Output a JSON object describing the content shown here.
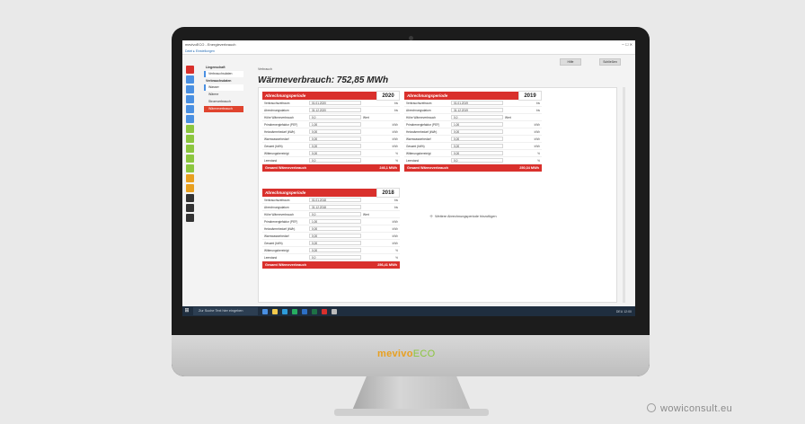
{
  "window": {
    "title": "mevivoECO - Energieverbrauch",
    "menu": "Datei  ▸  Einstellungen"
  },
  "toolbar": {
    "btn1": "Hilfe",
    "btn2": "Schließen"
  },
  "navigation": {
    "header1": "Liegenschaft",
    "header2": "Verbrauchsdaten",
    "items": [
      "Verbrauchsdaten",
      "Wasser",
      "Wärme",
      "Stromverbrauch",
      "Wärmeverbrauch"
    ]
  },
  "breadcrumb": "Verbrauch",
  "page_title": "Wärmeverbrauch: 752,85 MWh",
  "cards": [
    {
      "header": "Abrechnungsperiode",
      "year": "2020",
      "rows": [
        {
          "label": "Verbrauchszeitraum",
          "value": "01.01.2020",
          "extra": "",
          "unit": "bis"
        },
        {
          "label": "Abrechnungsdatum",
          "value": "31.12.2020",
          "extra": "",
          "unit": "bis"
        },
        {
          "label": "Höhe Wärmeverbrauch",
          "value": "0,0",
          "extra": "Wert",
          "unit": ""
        },
        {
          "label": "Primärenergiefaktor (PEF)",
          "value": "1,00",
          "extra": "",
          "unit": "kWh"
        },
        {
          "label": "Heizwärmebedarf (kWh)",
          "value": "0,00",
          "extra": "",
          "unit": "kWh"
        },
        {
          "label": "Warmwasserbedarf",
          "value": "0,00",
          "extra": "",
          "unit": "kWh"
        },
        {
          "label": "Gesamt (kWh)",
          "value": "0,00",
          "extra": "",
          "unit": "kWh"
        },
        {
          "label": "Witterungsbereinigt",
          "value": "0,00",
          "extra": "",
          "unit": "%"
        },
        {
          "label": "Leerstand",
          "value": "0,0",
          "extra": "",
          "unit": "%"
        }
      ],
      "footer_label": "Gesamt Wärmeverbrauch",
      "footer_value": "246,1 MWh"
    },
    {
      "header": "Abrechnungsperiode",
      "year": "2019",
      "rows": [
        {
          "label": "Verbrauchszeitraum",
          "value": "01.01.2019",
          "extra": "",
          "unit": "bis"
        },
        {
          "label": "Abrechnungsdatum",
          "value": "31.12.2019",
          "extra": "",
          "unit": "bis"
        },
        {
          "label": "Höhe Wärmeverbrauch",
          "value": "0,0",
          "extra": "Wert",
          "unit": ""
        },
        {
          "label": "Primärenergiefaktor (PEF)",
          "value": "1,00",
          "extra": "",
          "unit": "kWh"
        },
        {
          "label": "Heizwärmebedarf (kWh)",
          "value": "0,00",
          "extra": "",
          "unit": "kWh"
        },
        {
          "label": "Warmwasserbedarf",
          "value": "0,00",
          "extra": "",
          "unit": "kWh"
        },
        {
          "label": "Gesamt (kWh)",
          "value": "0,00",
          "extra": "",
          "unit": "kWh"
        },
        {
          "label": "Witterungsbereinigt",
          "value": "0,00",
          "extra": "",
          "unit": "%"
        },
        {
          "label": "Leerstand",
          "value": "0,0",
          "extra": "",
          "unit": "%"
        }
      ],
      "footer_label": "Gesamt Wärmeverbrauch",
      "footer_value": "250,34 MWh"
    },
    {
      "header": "Abrechnungsperiode",
      "year": "2018",
      "rows": [
        {
          "label": "Verbrauchszeitraum",
          "value": "01.01.2018",
          "extra": "",
          "unit": "bis"
        },
        {
          "label": "Abrechnungsdatum",
          "value": "31.12.2018",
          "extra": "",
          "unit": "bis"
        },
        {
          "label": "Höhe Wärmeverbrauch",
          "value": "0,0",
          "extra": "Wert",
          "unit": ""
        },
        {
          "label": "Primärenergiefaktor (PEF)",
          "value": "1,00",
          "extra": "",
          "unit": "kWh"
        },
        {
          "label": "Heizwärmebedarf (kWh)",
          "value": "0,00",
          "extra": "",
          "unit": "kWh"
        },
        {
          "label": "Warmwasserbedarf",
          "value": "0,00",
          "extra": "",
          "unit": "kWh"
        },
        {
          "label": "Gesamt (kWh)",
          "value": "0,00",
          "extra": "",
          "unit": "kWh"
        },
        {
          "label": "Witterungsbereinigt",
          "value": "0,00",
          "extra": "",
          "unit": "%"
        },
        {
          "label": "Leerstand",
          "value": "0,0",
          "extra": "",
          "unit": "%"
        }
      ],
      "footer_label": "Gesamt Wärmeverbrauch",
      "footer_value": "256,41 MWh"
    }
  ],
  "add_period": "Weitere Abrechnungsperiode hinzufügen",
  "taskbar": {
    "search_placeholder": "Zur Suche Text hier eingeben",
    "tray": "DEU  12:00"
  },
  "colors": {
    "accent": "#d9302c",
    "brand_orange": "#e8a020",
    "brand_green": "#8cc63f"
  },
  "brand": {
    "logo_main": "mevivo",
    "logo_sub": "ECO"
  },
  "watermark": "wowiconsult.eu"
}
